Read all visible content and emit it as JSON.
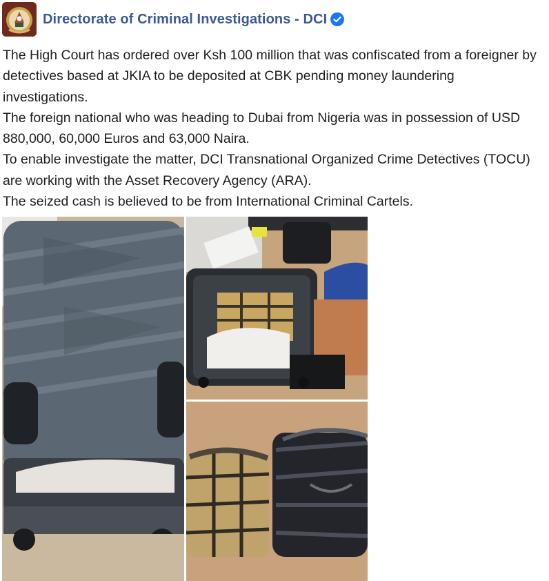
{
  "post": {
    "author": "Directorate of Criminal Investigations - DCI",
    "verified": true,
    "paragraphs": [
      "The High Court has ordered over Ksh 100 million that was confiscated from a foreigner by detectives based at JKIA to be deposited at CBK pending money laundering investigations.",
      "The foreign national who was heading to Dubai from Nigeria was in possession of USD 880,000, 60,000 Euros and 63,000 Naira.",
      "To enable investigate the matter, DCI Transnational Organized Crime Detectives (TOCU)  are working with the Asset Recovery Agency (ARA).",
      "The seized cash is believed to be from International Criminal Cartels."
    ]
  },
  "icons": {
    "avatar": "dci-crest-logo",
    "verified": "verified-badge-icon"
  },
  "colors": {
    "author_link": "#3b5998",
    "verified_badge": "#1877f2",
    "text": "#1c1e21"
  },
  "photo_grid": {
    "count": 3,
    "items": [
      "suitcase-closed-photo",
      "open-suitcase-with-cash-photo",
      "wrapped-cash-bundles-photo"
    ]
  }
}
